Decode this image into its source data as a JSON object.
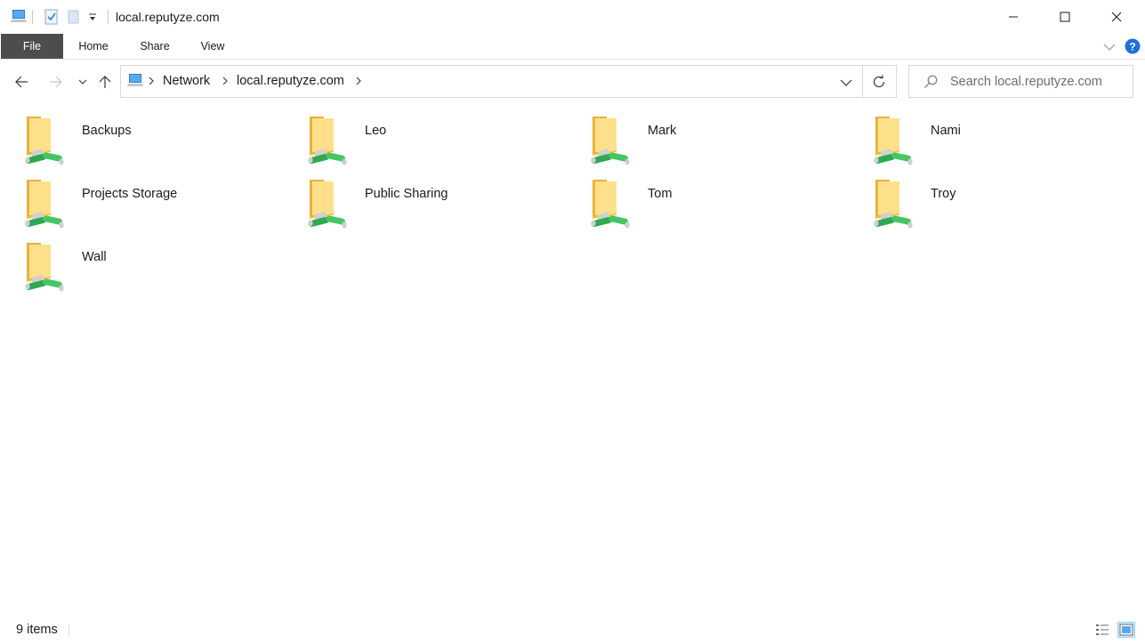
{
  "window": {
    "title": "local.reputyze.com",
    "quick_access": [
      "computer-icon",
      "properties-icon",
      "new-folder-icon",
      "customize-dropdown-icon"
    ],
    "controls": [
      "minimize",
      "maximize",
      "close"
    ]
  },
  "ribbon": {
    "tabs": [
      {
        "label": "File",
        "active": true
      },
      {
        "label": "Home"
      },
      {
        "label": "Share"
      },
      {
        "label": "View"
      }
    ]
  },
  "address_bar": {
    "breadcrumbs": [
      {
        "label": "Network"
      },
      {
        "label": "local.reputyze.com"
      }
    ]
  },
  "search": {
    "placeholder": "Search local.reputyze.com"
  },
  "items": [
    {
      "label": "Backups",
      "icon": "shared-folder-icon"
    },
    {
      "label": "Leo",
      "icon": "shared-folder-icon"
    },
    {
      "label": "Mark",
      "icon": "shared-folder-icon"
    },
    {
      "label": "Nami",
      "icon": "shared-folder-icon"
    },
    {
      "label": "Projects Storage",
      "icon": "shared-folder-icon"
    },
    {
      "label": "Public Sharing",
      "icon": "shared-folder-icon"
    },
    {
      "label": "Tom",
      "icon": "shared-folder-icon"
    },
    {
      "label": "Troy",
      "icon": "shared-folder-icon"
    },
    {
      "label": "Wall",
      "icon": "shared-folder-icon"
    }
  ],
  "status_bar": {
    "item_count": "9 items",
    "active_view": "large-icons"
  },
  "colors": {
    "file_tab": "#4d4d4d",
    "help_icon": "#1e6fd9",
    "folder": "#f3c74f",
    "share_pipe": "#2fa84f"
  }
}
